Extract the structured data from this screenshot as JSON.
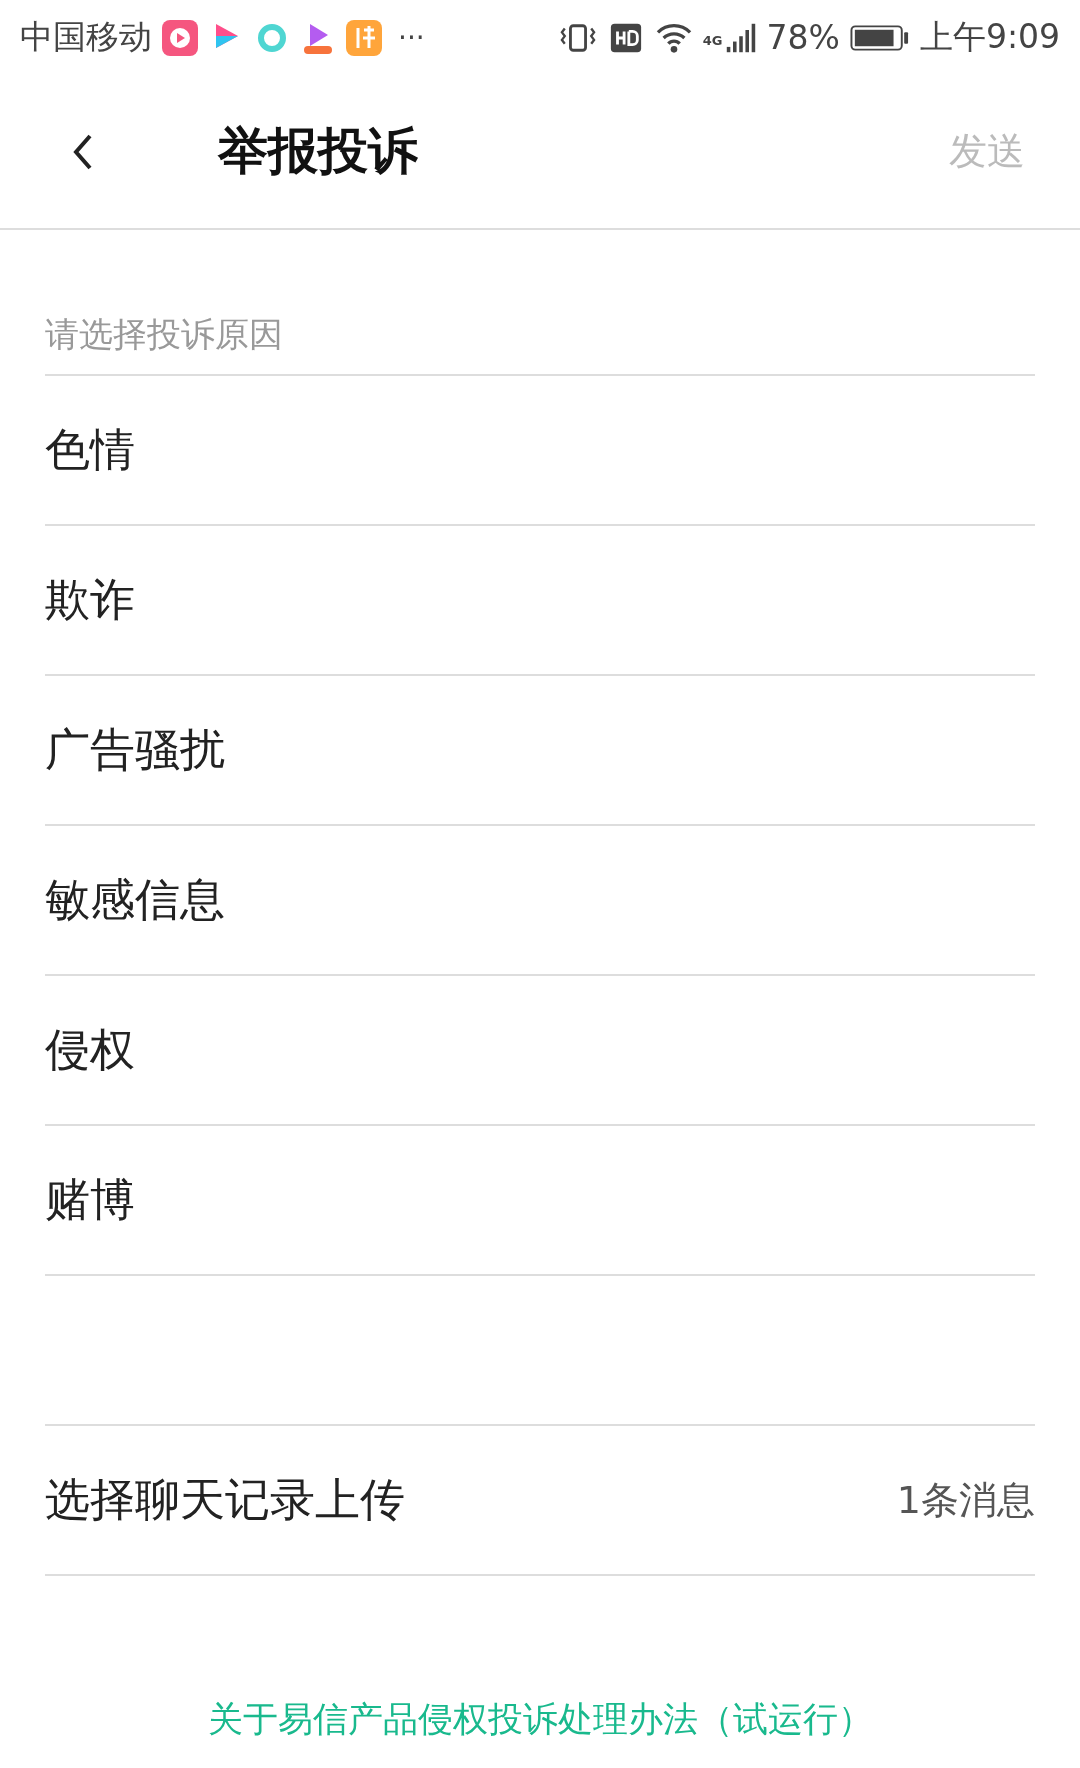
{
  "status_bar": {
    "carrier": "中国移动",
    "more": "···",
    "network": "4G",
    "battery_text": "78%",
    "time": "上午9:09"
  },
  "header": {
    "title": "举报投诉",
    "action": "发送",
    "action_disabled": true
  },
  "section_label": "请选择投诉原因",
  "reasons": [
    {
      "label": "色情",
      "selected": false
    },
    {
      "label": "欺诈",
      "selected": false
    },
    {
      "label": "广告骚扰",
      "selected": false
    },
    {
      "label": "敏感信息",
      "selected": false
    },
    {
      "label": "侵权",
      "selected": false
    },
    {
      "label": "赌博",
      "selected": false
    }
  ],
  "chat_upload": {
    "label": "选择聊天记录上传",
    "value": "1条消息"
  },
  "footer_link": "关于易信产品侵权投诉处理办法（试运行）"
}
